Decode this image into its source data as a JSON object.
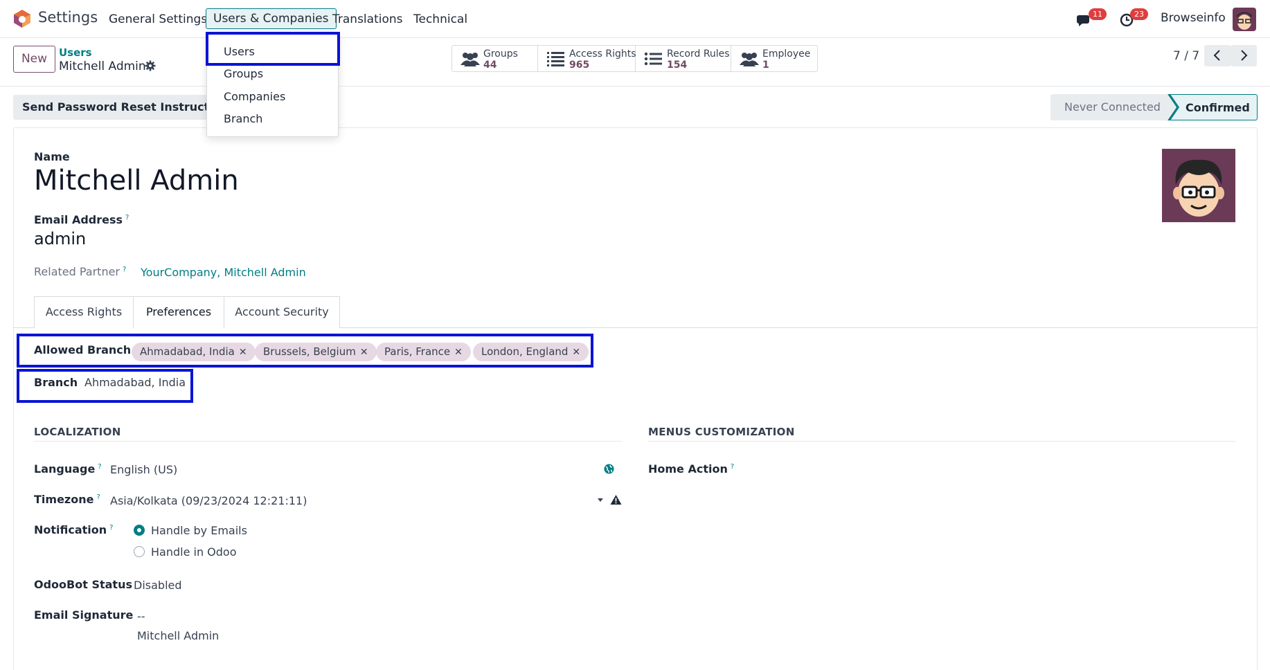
{
  "navbar": {
    "app_title": "Settings",
    "menus": [
      "General Settings",
      "Users & Companies",
      "Translations",
      "Technical"
    ],
    "messages_count": "11",
    "activities_count": "23",
    "company": "Browseinfo"
  },
  "dropdown": {
    "items": [
      "Users",
      "Groups",
      "Companies",
      "Branch"
    ]
  },
  "control": {
    "new_label": "New",
    "breadcrumb_parent": "Users",
    "breadcrumb_current": "Mitchell Admin",
    "smart_buttons": [
      {
        "label": "Groups",
        "value": "44"
      },
      {
        "label": "Access Rights",
        "value": "965"
      },
      {
        "label": "Record Rules",
        "value": "154"
      },
      {
        "label": "Employee",
        "value": "1"
      }
    ],
    "pager": "7 / 7"
  },
  "status": {
    "reset_button": "Send Password Reset Instructions",
    "stages": [
      "Never Connected",
      "Confirmed"
    ],
    "current_stage": "Confirmed"
  },
  "form": {
    "name_label": "Name",
    "name_value": "Mitchell Admin",
    "email_label": "Email Address",
    "email_value": "admin",
    "partner_label": "Related Partner",
    "partner_value": "YourCompany, Mitchell Admin",
    "tabs": [
      "Access Rights",
      "Preferences",
      "Account Security"
    ],
    "active_tab": "Preferences",
    "allowed_branch_label": "Allowed Branch",
    "allowed_branches": [
      "Ahmadabad, India",
      "Brussels, Belgium",
      "Paris, France",
      "London, England"
    ],
    "branch_label": "Branch",
    "branch_value": "Ahmadabad, India",
    "localization_title": "LOCALIZATION",
    "menus_title": "MENUS CUSTOMIZATION",
    "language_label": "Language",
    "language_value": "English (US)",
    "timezone_label": "Timezone",
    "timezone_value": "Asia/Kolkata (09/23/2024 12:21:11)",
    "notification_label": "Notification",
    "notification_options": [
      "Handle by Emails",
      "Handle in Odoo"
    ],
    "notification_selected": "Handle by Emails",
    "odoobot_label": "OdooBot Status",
    "odoobot_value": "Disabled",
    "signature_label": "Email Signature",
    "signature_line1": "--",
    "signature_line2": "Mitchell Admin",
    "home_action_label": "Home Action"
  },
  "colors": {
    "brand": "#714b67",
    "accent": "#017e84",
    "highlight": "#0a14d4",
    "badge": "#e03e3e"
  }
}
